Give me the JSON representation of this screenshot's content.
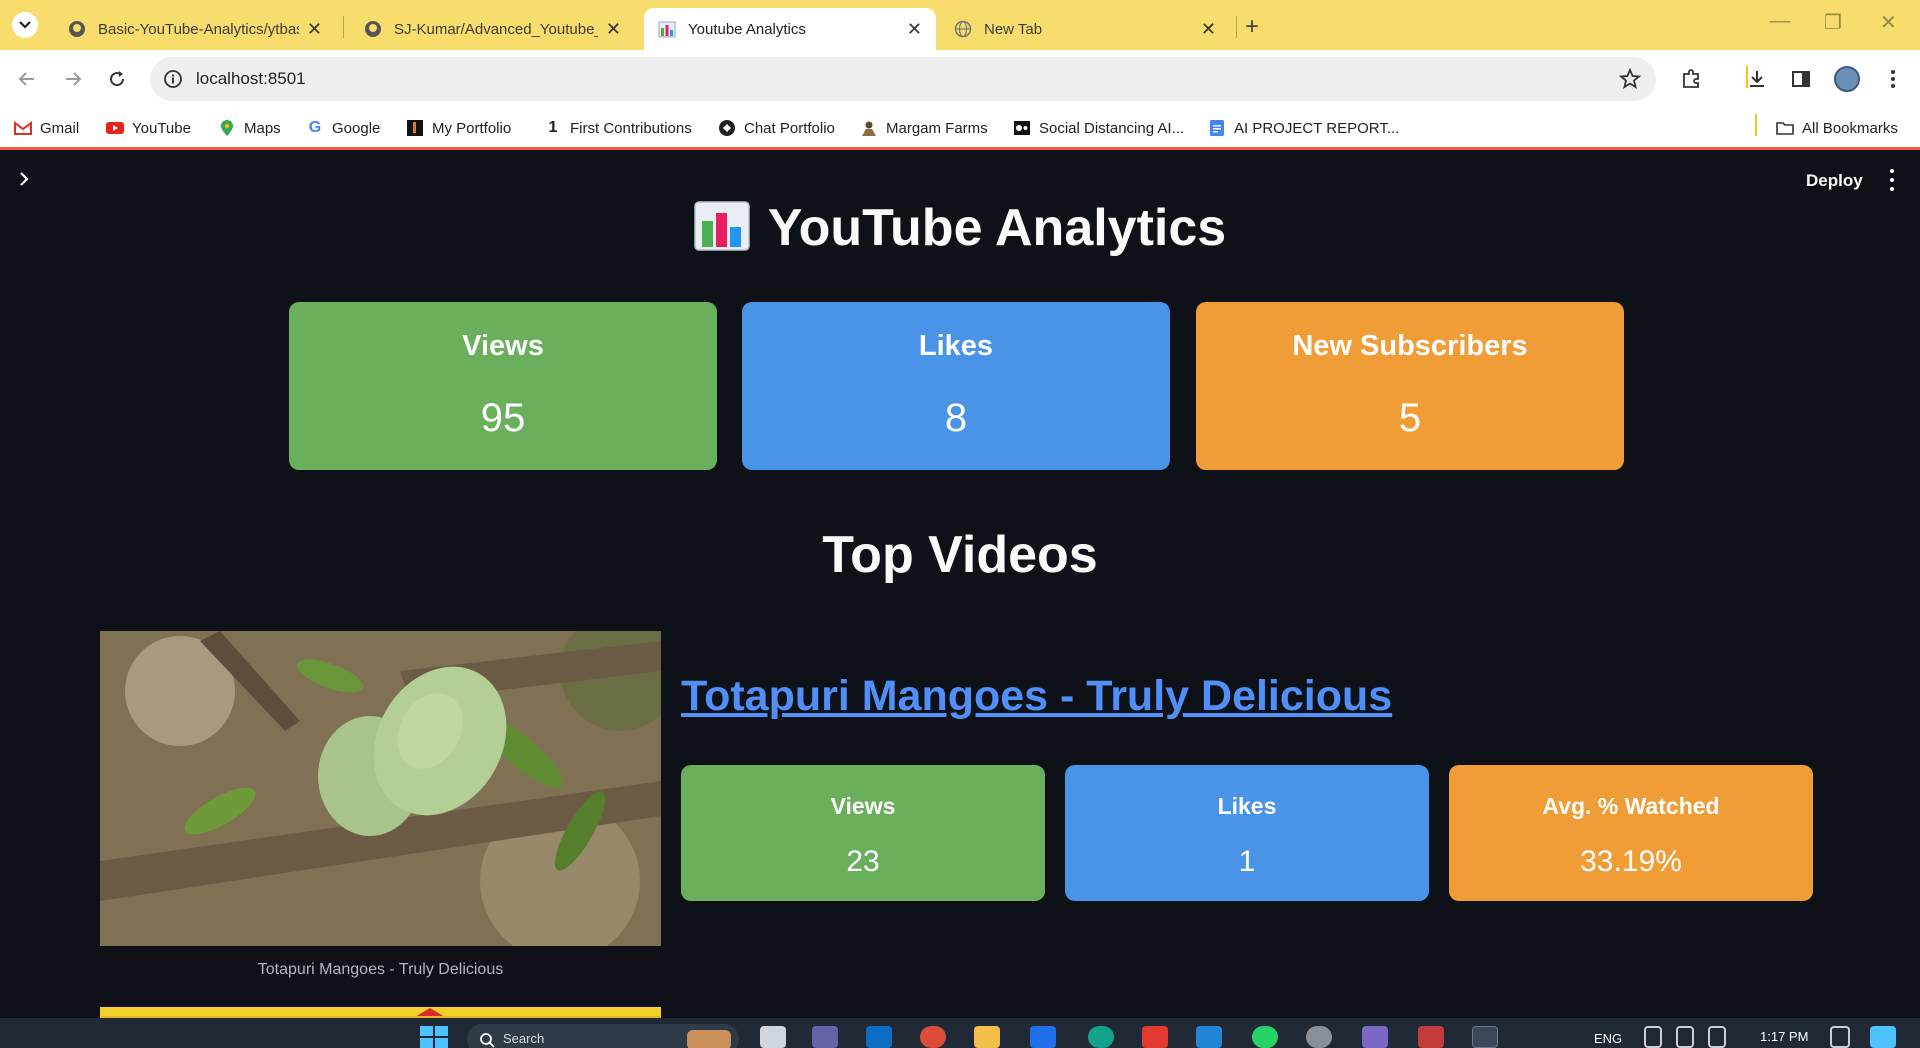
{
  "browser": {
    "tabs": [
      {
        "title": "Basic-YouTube-Analytics/ytbasic",
        "favicon": "github-icon"
      },
      {
        "title": "SJ-Kumar/Advanced_Youtube_A",
        "favicon": "github-icon"
      },
      {
        "title": "Youtube Analytics",
        "favicon": "bar-chart-icon",
        "active": true
      },
      {
        "title": "New Tab",
        "favicon": "globe-icon"
      }
    ],
    "url": "localhost:8501",
    "bookmarks": [
      {
        "label": "Gmail",
        "icon": "gmail-icon"
      },
      {
        "label": "YouTube",
        "icon": "youtube-icon"
      },
      {
        "label": "Maps",
        "icon": "maps-icon"
      },
      {
        "label": "Google",
        "icon": "google-icon"
      },
      {
        "label": "My Portfolio",
        "icon": "portfolio-icon"
      },
      {
        "label": "First Contributions",
        "icon": "first-contributions-icon"
      },
      {
        "label": "Chat Portfolio",
        "icon": "chat-portfolio-icon"
      },
      {
        "label": "Margam Farms",
        "icon": "margam-farms-icon"
      },
      {
        "label": "Social Distancing AI...",
        "icon": "social-distancing-icon"
      },
      {
        "label": "AI PROJECT REPORT...",
        "icon": "docs-icon"
      }
    ],
    "all_bookmarks_label": "All Bookmarks",
    "theme_color": "#f8dd6c"
  },
  "app": {
    "deploy_label": "Deploy",
    "title": "YouTube Analytics",
    "metrics": {
      "views": {
        "label": "Views",
        "value": "95"
      },
      "likes": {
        "label": "Likes",
        "value": "8"
      },
      "subscribers": {
        "label": "New Subscribers",
        "value": "5"
      }
    },
    "top_videos_title": "Top Videos",
    "videos": [
      {
        "title": "Totapuri Mangoes - Truly Delicious",
        "caption": "Totapuri Mangoes - Truly Delicious",
        "views": {
          "label": "Views",
          "value": "23"
        },
        "likes": {
          "label": "Likes",
          "value": "1"
        },
        "watched": {
          "label": "Avg. % Watched",
          "value": "33.19%"
        }
      }
    ],
    "colors": {
      "views": "#6aaf5c",
      "likes": "#4a94e8",
      "subscribers": "#f09d37",
      "link": "#4f8ff7",
      "background": "#0e1117"
    }
  },
  "taskbar": {
    "search_placeholder": "Search",
    "language": "ENG",
    "time": "1:17 PM"
  }
}
